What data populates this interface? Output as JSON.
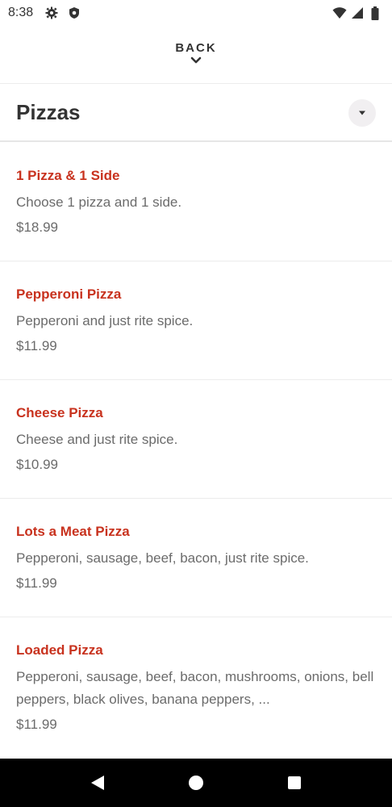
{
  "status_bar": {
    "time": "8:38",
    "left_icons": [
      "gear-icon",
      "shield-icon"
    ],
    "right_icons": [
      "wifi-icon",
      "signal-icon",
      "battery-icon"
    ]
  },
  "header": {
    "back_label": "BACK"
  },
  "category": {
    "title": "Pizzas"
  },
  "menu": {
    "items": [
      {
        "name": "1 Pizza & 1 Side",
        "description": "Choose 1 pizza and 1 side.",
        "price": "$18.99"
      },
      {
        "name": "Pepperoni Pizza",
        "description": "Pepperoni and just rite spice.",
        "price": "$11.99"
      },
      {
        "name": "Cheese Pizza",
        "description": "Cheese and just rite spice.",
        "price": "$10.99"
      },
      {
        "name": "Lots a Meat Pizza",
        "description": "Pepperoni, sausage, beef, bacon, just rite spice.",
        "price": "$11.99"
      },
      {
        "name": "Loaded Pizza",
        "description": "Pepperoni, sausage, beef, bacon, mushrooms, onions, bell peppers, black olives, banana peppers, ...",
        "price": "$11.99"
      }
    ]
  },
  "colors": {
    "accent": "#c8321e",
    "text_primary": "#333333",
    "text_secondary": "#6b6b6b",
    "nav_bar": "#000000"
  },
  "nav_bar": {
    "buttons": [
      "back-triangle-icon",
      "home-circle-icon",
      "recents-square-icon"
    ]
  }
}
